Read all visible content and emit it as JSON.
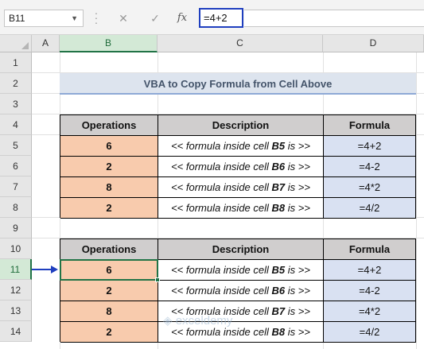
{
  "formula_bar": {
    "name_box": "B11",
    "name_box_dropdown_icon": "chevron-down-icon",
    "cancel_icon": "✕",
    "enter_icon": "✓",
    "fx_label": "fx",
    "formula": "=4+2"
  },
  "columns": [
    "A",
    "B",
    "C",
    "D"
  ],
  "rows": [
    "1",
    "2",
    "3",
    "4",
    "5",
    "6",
    "7",
    "8",
    "9",
    "10",
    "11",
    "12",
    "13",
    "14"
  ],
  "selected_cell": "B11",
  "title": "VBA to Copy Formula from Cell Above",
  "table1": {
    "headers": [
      "Operations",
      "Description",
      "Formula"
    ],
    "rows": [
      {
        "operation": "6",
        "desc_prefix": "<< formula inside cell ",
        "desc_cell": "B5",
        "desc_suffix": " is >>",
        "formula": "=4+2"
      },
      {
        "operation": "2",
        "desc_prefix": "<< formula inside cell ",
        "desc_cell": "B6",
        "desc_suffix": " is >>",
        "formula": "=4-2"
      },
      {
        "operation": "8",
        "desc_prefix": "<< formula inside cell ",
        "desc_cell": "B7",
        "desc_suffix": " is >>",
        "formula": "=4*2"
      },
      {
        "operation": "2",
        "desc_prefix": "<< formula inside cell ",
        "desc_cell": "B8",
        "desc_suffix": " is >>",
        "formula": "=4/2"
      }
    ]
  },
  "table2": {
    "headers": [
      "Operations",
      "Description",
      "Formula"
    ],
    "rows": [
      {
        "operation": "6",
        "desc_prefix": "<< formula inside cell ",
        "desc_cell": "B5",
        "desc_suffix": " is >>",
        "formula": "=4+2"
      },
      {
        "operation": "2",
        "desc_prefix": "<< formula inside cell ",
        "desc_cell": "B6",
        "desc_suffix": " is >>",
        "formula": "=4-2"
      },
      {
        "operation": "8",
        "desc_prefix": "<< formula inside cell ",
        "desc_cell": "B7",
        "desc_suffix": " is >>",
        "formula": "=4*2"
      },
      {
        "operation": "2",
        "desc_prefix": "<< formula inside cell ",
        "desc_cell": "B8",
        "desc_suffix": " is >>",
        "formula": "=4/2"
      }
    ]
  },
  "watermark": "exceldemy",
  "colors": {
    "accent_green": "#217346",
    "operations_fill": "#f8cbad",
    "formula_fill": "#d9e1f2",
    "header_fill": "#d0cece",
    "title_fill": "#dde4ee",
    "arrow": "#1f3fbf"
  }
}
